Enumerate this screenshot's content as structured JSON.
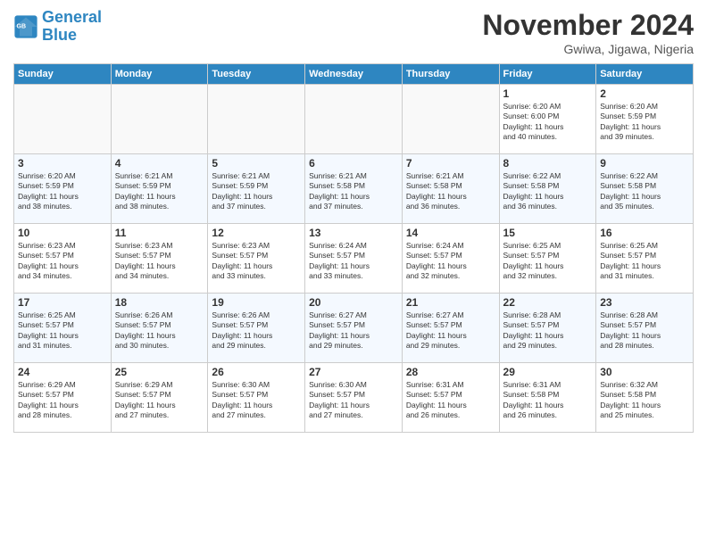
{
  "header": {
    "logo_line1": "General",
    "logo_line2": "Blue",
    "month_title": "November 2024",
    "location": "Gwiwa, Jigawa, Nigeria"
  },
  "days_of_week": [
    "Sunday",
    "Monday",
    "Tuesday",
    "Wednesday",
    "Thursday",
    "Friday",
    "Saturday"
  ],
  "weeks": [
    [
      {
        "day": "",
        "info": ""
      },
      {
        "day": "",
        "info": ""
      },
      {
        "day": "",
        "info": ""
      },
      {
        "day": "",
        "info": ""
      },
      {
        "day": "",
        "info": ""
      },
      {
        "day": "1",
        "info": "Sunrise: 6:20 AM\nSunset: 6:00 PM\nDaylight: 11 hours\nand 40 minutes."
      },
      {
        "day": "2",
        "info": "Sunrise: 6:20 AM\nSunset: 5:59 PM\nDaylight: 11 hours\nand 39 minutes."
      }
    ],
    [
      {
        "day": "3",
        "info": "Sunrise: 6:20 AM\nSunset: 5:59 PM\nDaylight: 11 hours\nand 38 minutes."
      },
      {
        "day": "4",
        "info": "Sunrise: 6:21 AM\nSunset: 5:59 PM\nDaylight: 11 hours\nand 38 minutes."
      },
      {
        "day": "5",
        "info": "Sunrise: 6:21 AM\nSunset: 5:59 PM\nDaylight: 11 hours\nand 37 minutes."
      },
      {
        "day": "6",
        "info": "Sunrise: 6:21 AM\nSunset: 5:58 PM\nDaylight: 11 hours\nand 37 minutes."
      },
      {
        "day": "7",
        "info": "Sunrise: 6:21 AM\nSunset: 5:58 PM\nDaylight: 11 hours\nand 36 minutes."
      },
      {
        "day": "8",
        "info": "Sunrise: 6:22 AM\nSunset: 5:58 PM\nDaylight: 11 hours\nand 36 minutes."
      },
      {
        "day": "9",
        "info": "Sunrise: 6:22 AM\nSunset: 5:58 PM\nDaylight: 11 hours\nand 35 minutes."
      }
    ],
    [
      {
        "day": "10",
        "info": "Sunrise: 6:23 AM\nSunset: 5:57 PM\nDaylight: 11 hours\nand 34 minutes."
      },
      {
        "day": "11",
        "info": "Sunrise: 6:23 AM\nSunset: 5:57 PM\nDaylight: 11 hours\nand 34 minutes."
      },
      {
        "day": "12",
        "info": "Sunrise: 6:23 AM\nSunset: 5:57 PM\nDaylight: 11 hours\nand 33 minutes."
      },
      {
        "day": "13",
        "info": "Sunrise: 6:24 AM\nSunset: 5:57 PM\nDaylight: 11 hours\nand 33 minutes."
      },
      {
        "day": "14",
        "info": "Sunrise: 6:24 AM\nSunset: 5:57 PM\nDaylight: 11 hours\nand 32 minutes."
      },
      {
        "day": "15",
        "info": "Sunrise: 6:25 AM\nSunset: 5:57 PM\nDaylight: 11 hours\nand 32 minutes."
      },
      {
        "day": "16",
        "info": "Sunrise: 6:25 AM\nSunset: 5:57 PM\nDaylight: 11 hours\nand 31 minutes."
      }
    ],
    [
      {
        "day": "17",
        "info": "Sunrise: 6:25 AM\nSunset: 5:57 PM\nDaylight: 11 hours\nand 31 minutes."
      },
      {
        "day": "18",
        "info": "Sunrise: 6:26 AM\nSunset: 5:57 PM\nDaylight: 11 hours\nand 30 minutes."
      },
      {
        "day": "19",
        "info": "Sunrise: 6:26 AM\nSunset: 5:57 PM\nDaylight: 11 hours\nand 29 minutes."
      },
      {
        "day": "20",
        "info": "Sunrise: 6:27 AM\nSunset: 5:57 PM\nDaylight: 11 hours\nand 29 minutes."
      },
      {
        "day": "21",
        "info": "Sunrise: 6:27 AM\nSunset: 5:57 PM\nDaylight: 11 hours\nand 29 minutes."
      },
      {
        "day": "22",
        "info": "Sunrise: 6:28 AM\nSunset: 5:57 PM\nDaylight: 11 hours\nand 29 minutes."
      },
      {
        "day": "23",
        "info": "Sunrise: 6:28 AM\nSunset: 5:57 PM\nDaylight: 11 hours\nand 28 minutes."
      }
    ],
    [
      {
        "day": "24",
        "info": "Sunrise: 6:29 AM\nSunset: 5:57 PM\nDaylight: 11 hours\nand 28 minutes."
      },
      {
        "day": "25",
        "info": "Sunrise: 6:29 AM\nSunset: 5:57 PM\nDaylight: 11 hours\nand 27 minutes."
      },
      {
        "day": "26",
        "info": "Sunrise: 6:30 AM\nSunset: 5:57 PM\nDaylight: 11 hours\nand 27 minutes."
      },
      {
        "day": "27",
        "info": "Sunrise: 6:30 AM\nSunset: 5:57 PM\nDaylight: 11 hours\nand 27 minutes."
      },
      {
        "day": "28",
        "info": "Sunrise: 6:31 AM\nSunset: 5:57 PM\nDaylight: 11 hours\nand 26 minutes."
      },
      {
        "day": "29",
        "info": "Sunrise: 6:31 AM\nSunset: 5:58 PM\nDaylight: 11 hours\nand 26 minutes."
      },
      {
        "day": "30",
        "info": "Sunrise: 6:32 AM\nSunset: 5:58 PM\nDaylight: 11 hours\nand 25 minutes."
      }
    ]
  ]
}
